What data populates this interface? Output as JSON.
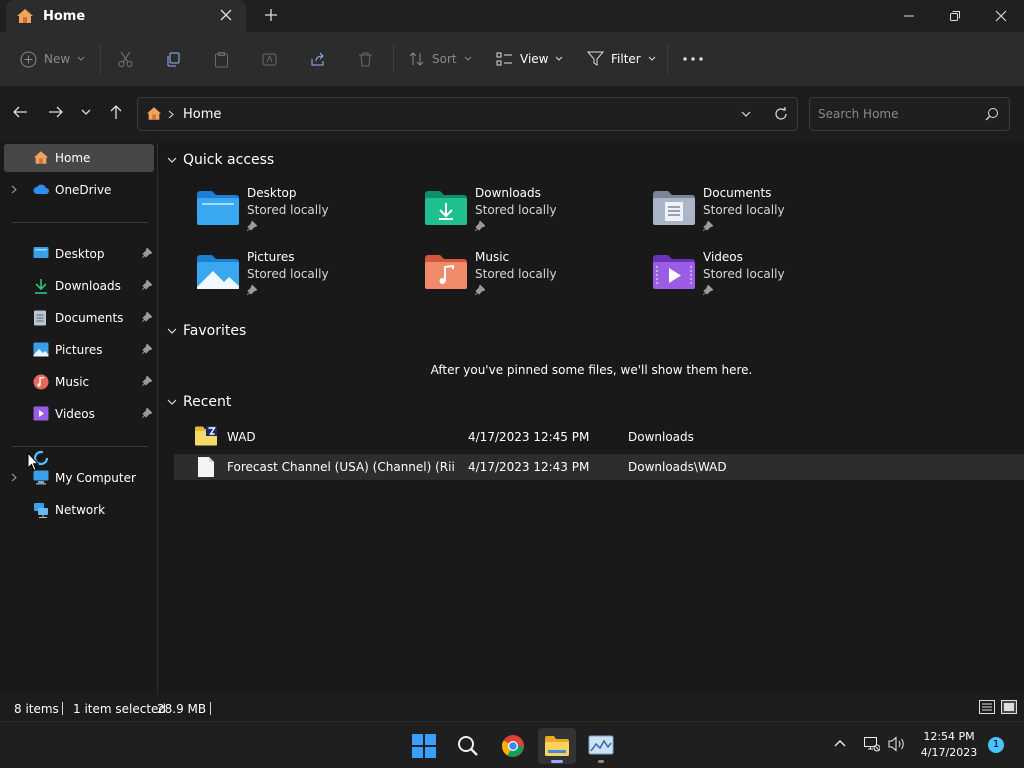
{
  "window": {
    "tab_title": "Home"
  },
  "commandbar": {
    "new_label": "New",
    "sort_label": "Sort",
    "view_label": "View",
    "filter_label": "Filter"
  },
  "address": {
    "current": "Home"
  },
  "search": {
    "placeholder": "Search Home"
  },
  "sidebar": {
    "home": "Home",
    "onedrive": "OneDrive",
    "pinned": [
      {
        "label": "Desktop"
      },
      {
        "label": "Downloads"
      },
      {
        "label": "Documents"
      },
      {
        "label": "Pictures"
      },
      {
        "label": "Music"
      },
      {
        "label": "Videos"
      }
    ],
    "my_computer": "My Computer",
    "network": "Network"
  },
  "quick_access": {
    "header": "Quick access",
    "items": [
      {
        "name": "Desktop",
        "status": "Stored locally",
        "icon": "desktop-folder-icon"
      },
      {
        "name": "Downloads",
        "status": "Stored locally",
        "icon": "downloads-folder-icon"
      },
      {
        "name": "Documents",
        "status": "Stored locally",
        "icon": "documents-folder-icon"
      },
      {
        "name": "Pictures",
        "status": "Stored locally",
        "icon": "pictures-folder-icon"
      },
      {
        "name": "Music",
        "status": "Stored locally",
        "icon": "music-folder-icon"
      },
      {
        "name": "Videos",
        "status": "Stored locally",
        "icon": "videos-folder-icon"
      }
    ]
  },
  "favorites": {
    "header": "Favorites",
    "empty_message": "After you've pinned some files, we'll show them here."
  },
  "recent": {
    "header": "Recent",
    "items": [
      {
        "name": "WAD",
        "date": "4/17/2023 12:45 PM",
        "location": "Downloads"
      },
      {
        "name": "Forecast Channel (USA) (Channel) (RiiCo...",
        "date": "4/17/2023 12:43 PM",
        "location": "Downloads\\WAD"
      }
    ]
  },
  "status": {
    "items_count": "8 items",
    "selection": "1 item selected",
    "size": "28.9 MB"
  },
  "taskbar": {
    "time": "12:54 PM",
    "date": "4/17/2023",
    "notification_count": "1"
  },
  "colors": {
    "accent": "#4cc2ff",
    "folder_yellow": "#f4cc5c",
    "selected_bg": "#474747"
  }
}
